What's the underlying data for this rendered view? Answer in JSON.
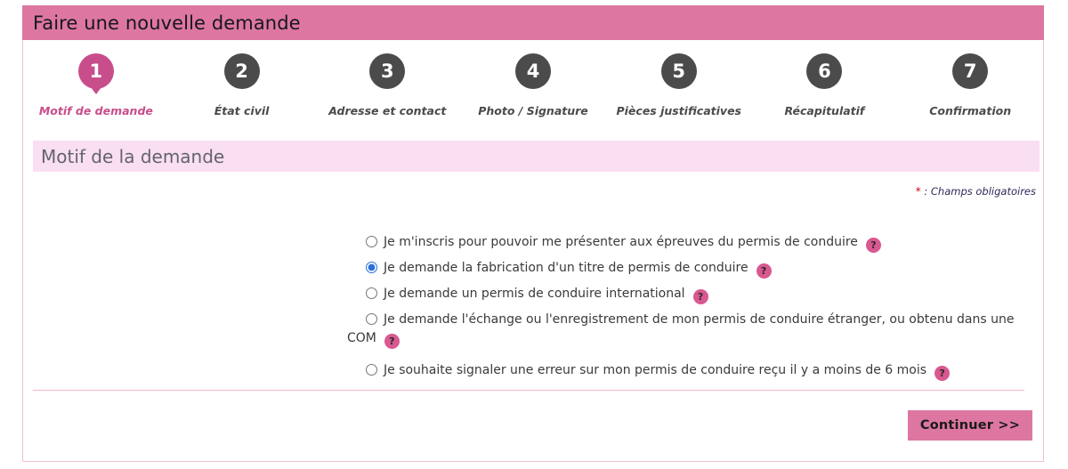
{
  "header": {
    "title": "Faire une nouvelle demande"
  },
  "stepper": {
    "steps": [
      {
        "number": "1",
        "label": "Motif de demande",
        "active": true
      },
      {
        "number": "2",
        "label": "État civil",
        "active": false
      },
      {
        "number": "3",
        "label": "Adresse et contact",
        "active": false
      },
      {
        "number": "4",
        "label": "Photo / Signature",
        "active": false
      },
      {
        "number": "5",
        "label": "Pièces justificatives",
        "active": false
      },
      {
        "number": "6",
        "label": "Récapitulatif",
        "active": false
      },
      {
        "number": "7",
        "label": "Confirmation",
        "active": false
      }
    ]
  },
  "section": {
    "title": "Motif de la demande"
  },
  "mandatory_note": {
    "star": "*",
    "text": " : Champs obligatoires"
  },
  "form": {
    "help_icon_label": "?",
    "options": [
      {
        "label": "Je m'inscris pour pouvoir me présenter aux épreuves du permis de conduire",
        "selected": false
      },
      {
        "label": "Je demande la fabrication d'un titre de permis de conduire",
        "selected": true
      },
      {
        "label": "Je demande un permis de conduire international",
        "selected": false
      },
      {
        "label": "Je demande l'échange ou l'enregistrement de mon permis de conduire étranger, ou obtenu dans une COM",
        "selected": false
      },
      {
        "label": "Je souhaite signaler une erreur sur mon permis de conduire reçu il y a moins de 6 mois",
        "selected": false
      }
    ]
  },
  "footer": {
    "continue_label": "Continuer >>"
  },
  "colors": {
    "header_bar": "#dd77a1",
    "active_step": "#c84e8b",
    "inactive_step": "#4b4b4b",
    "section_header_bg": "#fadef2",
    "help_icon": "#d9588f",
    "frame_border": "#f2bdd6",
    "divider": "#f0b6cf",
    "required_star": "#d0021b",
    "radio_selected": "#2a6fdb"
  }
}
